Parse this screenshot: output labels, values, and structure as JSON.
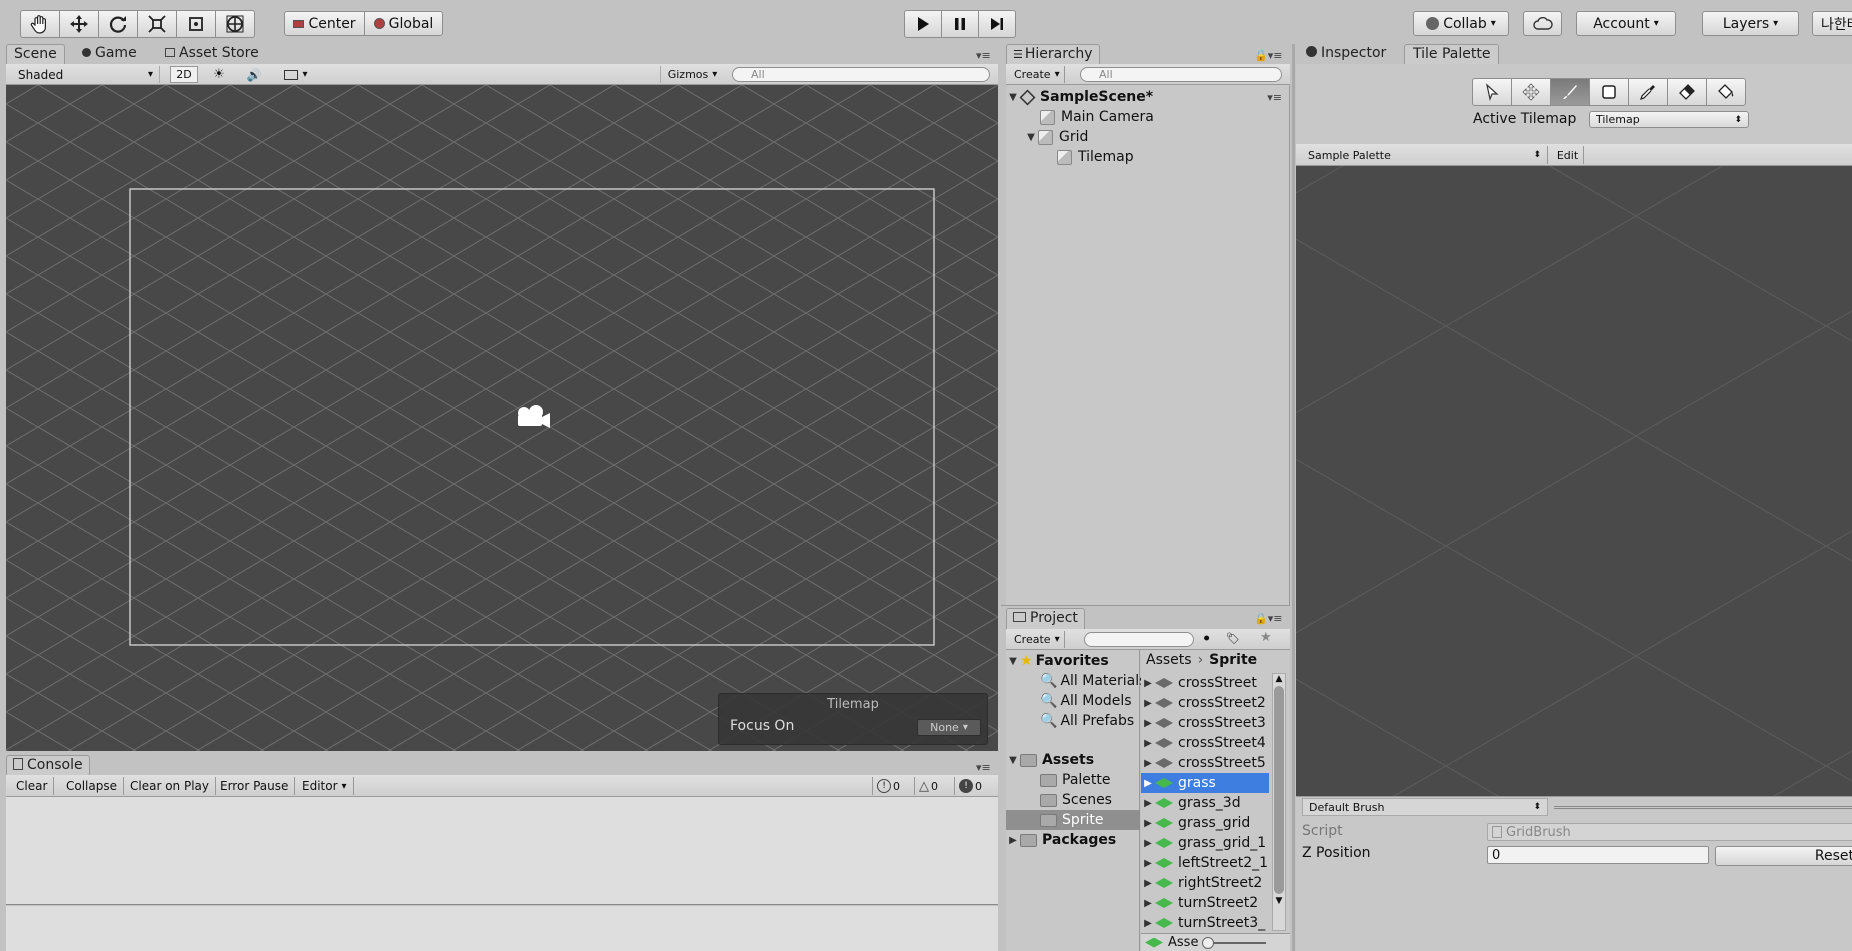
{
  "toolbar": {
    "pivot_label": "Center",
    "space_label": "Global",
    "collab_label": "Collab",
    "account_label": "Account",
    "layers_label": "Layers",
    "layout_label": "나한테"
  },
  "scene_panel": {
    "tabs": [
      "Scene",
      "Game",
      "Asset Store"
    ],
    "shading_mode": "Shaded",
    "mode_2d_label": "2D",
    "gizmos_label": "Gizmos",
    "search_placeholder": "All"
  },
  "tilemap_overlay": {
    "title": "Tilemap",
    "focus_label": "Focus On",
    "focus_value": "None"
  },
  "console": {
    "tab": "Console",
    "buttons": [
      "Clear",
      "Collapse",
      "Clear on Play",
      "Error Pause",
      "Editor"
    ],
    "log_count": "0",
    "warning_count": "0",
    "error_count": "0"
  },
  "hierarchy": {
    "tab": "Hierarchy",
    "create_label": "Create",
    "search_placeholder": "All",
    "scene_name": "SampleScene*",
    "items": [
      "Main Camera",
      "Grid",
      "Tilemap"
    ]
  },
  "project": {
    "tab": "Project",
    "create_label": "Create",
    "favorites_label": "Favorites",
    "favorites": [
      "All Materials",
      "All Models",
      "All Prefabs"
    ],
    "assets_label": "Assets",
    "asset_folders": [
      "Palette",
      "Scenes",
      "Sprite"
    ],
    "packages_label": "Packages",
    "breadcrumb": [
      "Assets",
      "Sprite"
    ],
    "files": [
      "crossStreet",
      "crossStreet2",
      "crossStreet3",
      "crossStreet4",
      "crossStreet5",
      "grass",
      "grass_3d",
      "grass_grid",
      "grass_grid_1",
      "leftStreet2_1",
      "rightStreet2",
      "turnStreet2",
      "turnStreet3_"
    ],
    "selected_file": "grass",
    "footer_label": "Asse"
  },
  "inspector": {
    "tab_inspector": "Inspector",
    "tab_tile_palette": "Tile Palette",
    "active_tilemap_label": "Active Tilemap",
    "active_tilemap_value": "Tilemap",
    "palette_name": "Sample Palette",
    "edit_label": "Edit",
    "brush_name": "Default Brush",
    "script_label": "Script",
    "script_value": "GridBrush",
    "z_position_label": "Z Position",
    "z_position_value": "0",
    "reset_label": "Reset"
  }
}
